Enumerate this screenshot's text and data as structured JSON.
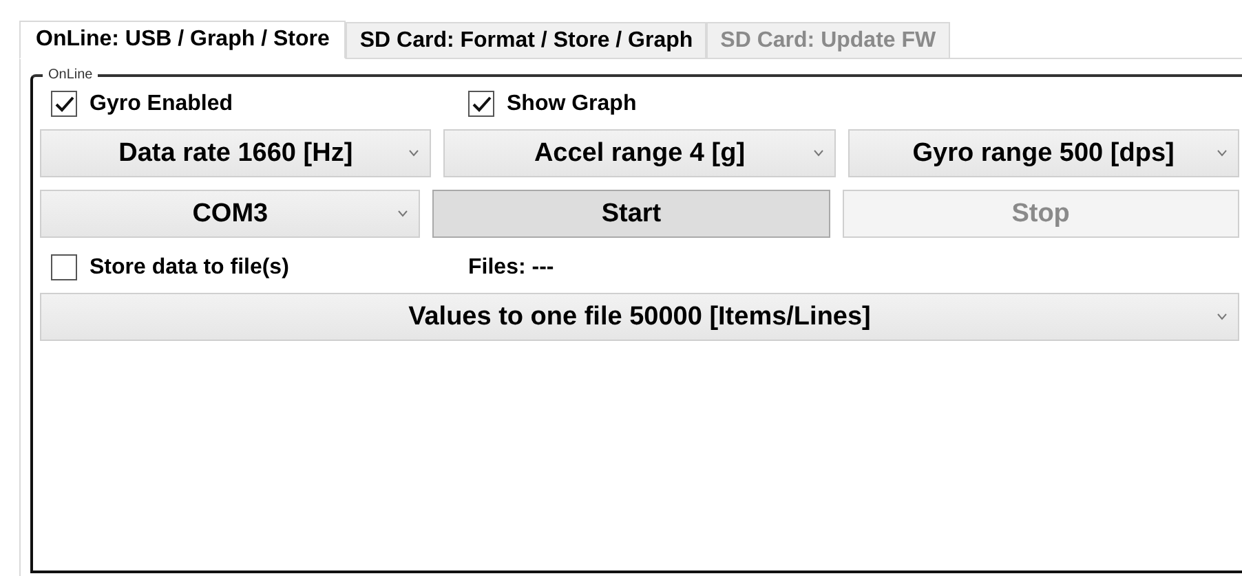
{
  "tabs": [
    {
      "label": "OnLine: USB / Graph / Store",
      "selected": true,
      "disabled": false
    },
    {
      "label": "SD Card: Format / Store / Graph",
      "selected": false,
      "disabled": false
    },
    {
      "label": "SD Card: Update FW",
      "selected": false,
      "disabled": true
    }
  ],
  "group": {
    "title": "OnLine"
  },
  "rows": [
    [
      {
        "kind": "checkbox",
        "label": "Gyro Enabled",
        "checked": true
      },
      {
        "kind": "checkbox",
        "label": "Show Graph",
        "checked": true
      }
    ],
    [
      {
        "kind": "dropdown",
        "value": "Data rate 1660 [Hz]"
      },
      {
        "kind": "dropdown",
        "value": "Accel range 4 [g]"
      },
      {
        "kind": "dropdown",
        "value": "Gyro range 500 [dps]"
      }
    ],
    [
      {
        "kind": "dropdown",
        "value": "COM3"
      },
      {
        "kind": "button",
        "label": "Start",
        "disabled": false
      },
      {
        "kind": "button",
        "label": "Stop",
        "disabled": true
      }
    ],
    [
      {
        "kind": "checkbox",
        "label": "Store data to file(s)",
        "checked": false
      },
      {
        "kind": "text",
        "label": "Files: ---"
      }
    ],
    [
      {
        "kind": "dropdown",
        "value": "Values to one file 50000 [Items/Lines]"
      }
    ]
  ]
}
